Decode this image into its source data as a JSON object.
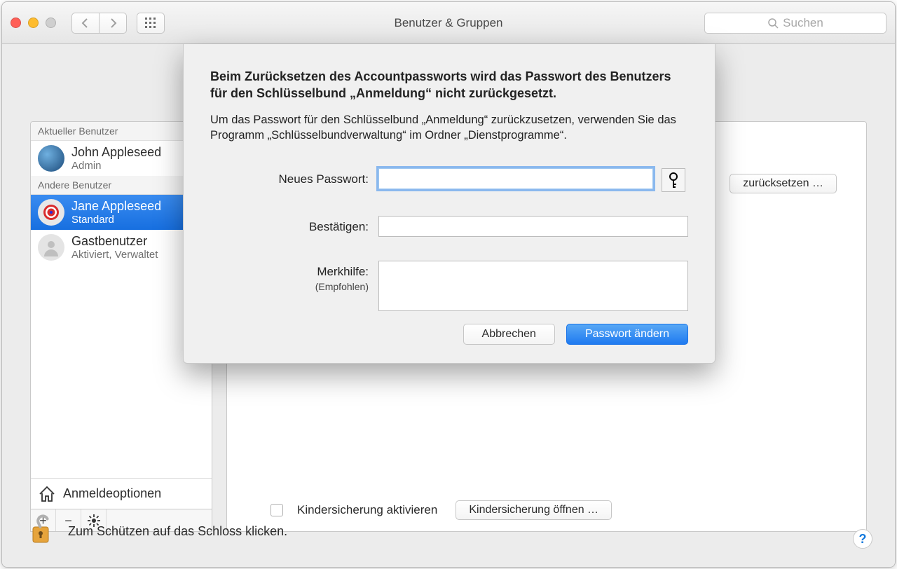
{
  "window": {
    "title": "Benutzer & Gruppen"
  },
  "search": {
    "placeholder": "Suchen"
  },
  "sidebar": {
    "current_header": "Aktueller Benutzer",
    "others_header": "Andere Benutzer",
    "current": {
      "name": "John Appleseed",
      "role": "Admin"
    },
    "others": [
      {
        "name": "Jane Appleseed",
        "role": "Standard",
        "selected": true
      },
      {
        "name": "Gastbenutzer",
        "role": "Aktiviert, Verwaltet"
      }
    ],
    "login_options": "Anmeldeoptionen"
  },
  "main": {
    "reset_button": "zurücksetzen …",
    "parental_enable": "Kindersicherung aktivieren",
    "parental_open": "Kindersicherung öffnen …"
  },
  "lock_hint": "Zum Schützen auf das Schloss klicken.",
  "dialog": {
    "title": "Beim Zurücksetzen des Accountpassworts wird das Passwort des Benutzers für den Schlüsselbund „Anmeldung“ nicht zurückgesetzt.",
    "subtitle": "Um das Passwort für den Schlüsselbund „Anmeldung“ zurückzusetzen, verwenden Sie das Programm „Schlüsselbundverwaltung“ im Ordner „Dienstprogramme“.",
    "new_password_label": "Neues Passwort:",
    "verify_label": "Bestätigen:",
    "hint_label": "Merkhilfe:",
    "hint_sub": "(Empfohlen)",
    "cancel": "Abbrechen",
    "confirm": "Passwort ändern",
    "fields": {
      "new_password": "",
      "verify": "",
      "hint": ""
    }
  },
  "icons": {
    "back": "chevron-left-icon",
    "forward": "chevron-right-icon",
    "grid": "grid-icon",
    "search": "search-icon",
    "house": "house-icon",
    "plus": "plus-icon",
    "minus": "minus-icon",
    "gear": "gear-icon",
    "key": "key-icon",
    "lock": "unlocked-lock-icon",
    "help": "help-icon"
  }
}
